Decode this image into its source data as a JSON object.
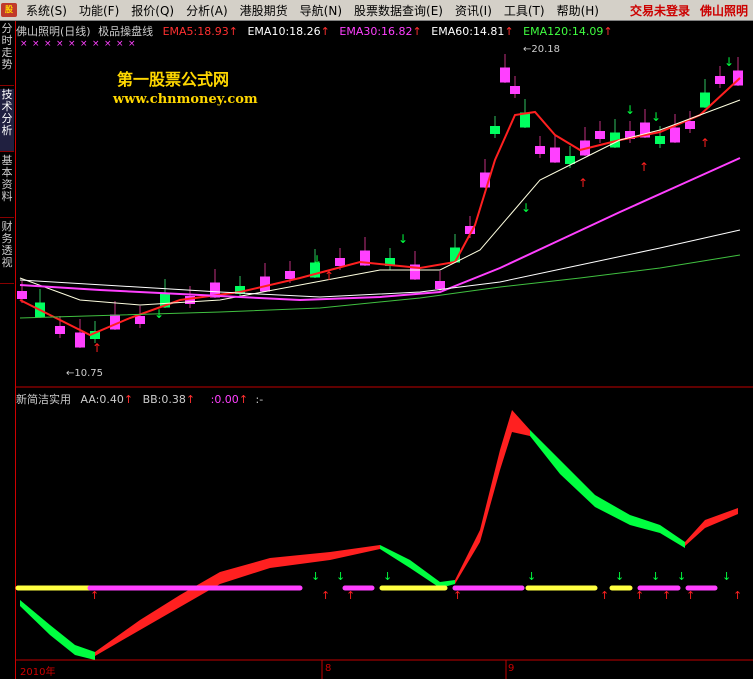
{
  "menu": {
    "items": [
      "系统(S)",
      "功能(F)",
      "报价(Q)",
      "分析(A)",
      "港股期货",
      "导航(N)",
      "股票数据查询(E)",
      "资讯(I)",
      "工具(T)",
      "帮助(H)"
    ],
    "status": "交易未登录",
    "stock_short": "佛山照明"
  },
  "side_tabs": [
    "分时走势",
    "技术分析",
    "基本资料",
    "财务透视"
  ],
  "main_chart": {
    "stock": "佛山照明(日线)",
    "indicator_name": "极品操盘线",
    "ema": [
      {
        "label": "EMA5:",
        "value": "18.93",
        "color": "#ff3030"
      },
      {
        "label": "EMA10:",
        "value": "18.26",
        "color": "#ffffff"
      },
      {
        "label": "EMA30:",
        "value": "16.82",
        "color": "#ff40ff"
      },
      {
        "label": "EMA60:",
        "value": "14.81",
        "color": "#ffffff"
      },
      {
        "label": "EMA120:",
        "value": "14.09",
        "color": "#40ff40"
      }
    ],
    "high_label": "20.18",
    "low_label": "10.75"
  },
  "watermark": {
    "cn": "第一股票公式网",
    "url": "www.chnmoney.com"
  },
  "indicator": {
    "name": "新简洁实用",
    "aa": "AA:0.40",
    "bb": "BB:0.38",
    "cc": ":0.00",
    "dd": ":-"
  },
  "date_axis": {
    "labels": [
      "2010年",
      "8",
      "9"
    ]
  },
  "colors": {
    "up": "#ff40ff",
    "down": "#00ff60",
    "red": "#ff2020",
    "yellow": "#ffff40",
    "green": "#00ff40",
    "magenta": "#ff40ff",
    "frame": "#c00000"
  }
}
